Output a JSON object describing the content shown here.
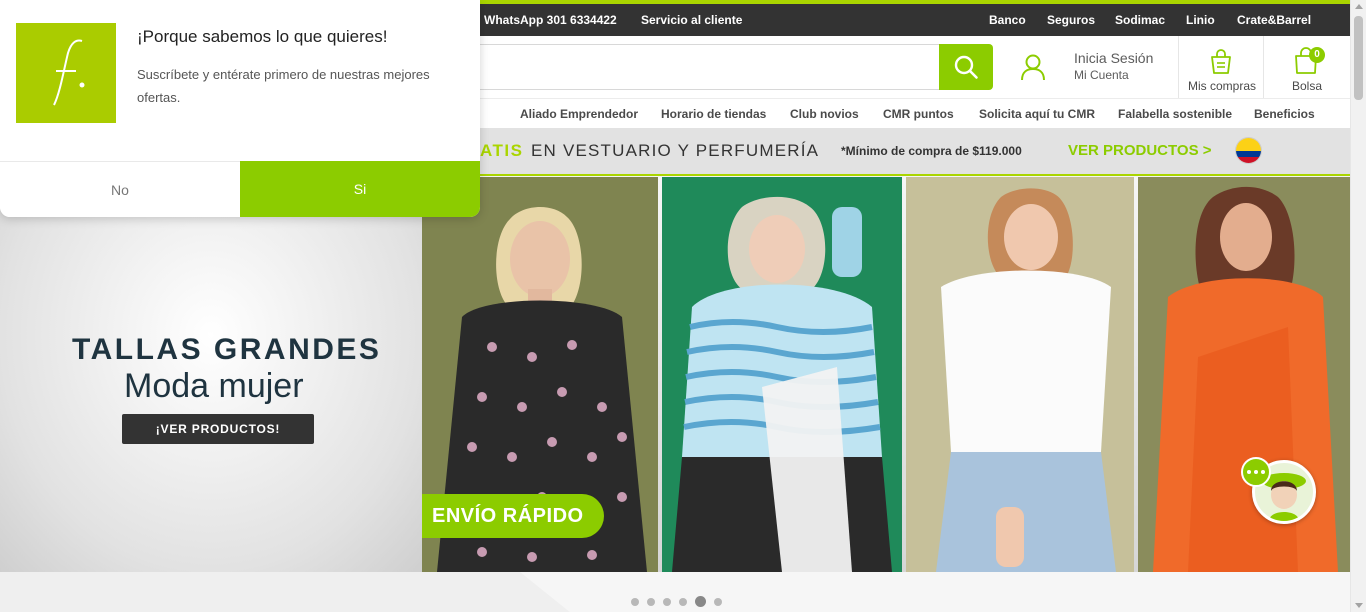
{
  "topbar": {
    "items": [
      "WhatsApp 301 6334422",
      "Servicio al cliente",
      "Banco",
      "Seguros",
      "Sodimac",
      "Linio",
      "Crate&Barrel"
    ]
  },
  "search": {
    "placeholder": "",
    "icon": "search-icon"
  },
  "account": {
    "title": "Inicia Sesión",
    "subtitle": "Mi Cuenta"
  },
  "purchases": {
    "label": "Mis compras"
  },
  "bag": {
    "label": "Bolsa",
    "count": "0"
  },
  "nav": {
    "items": [
      "Aliado Emprendedor",
      "Horario de tiendas",
      "Club novios",
      "CMR puntos",
      "Solicita aquí tu CMR",
      "Falabella sostenible",
      "Beneficios"
    ]
  },
  "promo": {
    "highlight": "ATIS",
    "text": "EN VESTUARIO Y PERFUMERÍA",
    "minimum": "*Mínimo de compra de $119.000",
    "link": "VER PRODUCTOS >",
    "flag": "colombia-flag"
  },
  "banner": {
    "title": "TALLAS GRANDES",
    "subtitle": "Moda mujer",
    "button": "¡VER PRODUCTOS!",
    "badge": "ENVÍO RÁPIDO",
    "slides_total": 6,
    "active_slide": 5
  },
  "popup": {
    "title": "¡Porque sabemos lo que quieres!",
    "text": "Suscríbete y entérate primero de nuestras mejores ofertas.",
    "logo_letter": "f.",
    "no_label": "No",
    "yes_label": "Si"
  },
  "colors": {
    "brand_green": "#8ccc00",
    "accent_green": "#aad500",
    "topbar": "#333333",
    "dark_text": "#1f3440"
  }
}
